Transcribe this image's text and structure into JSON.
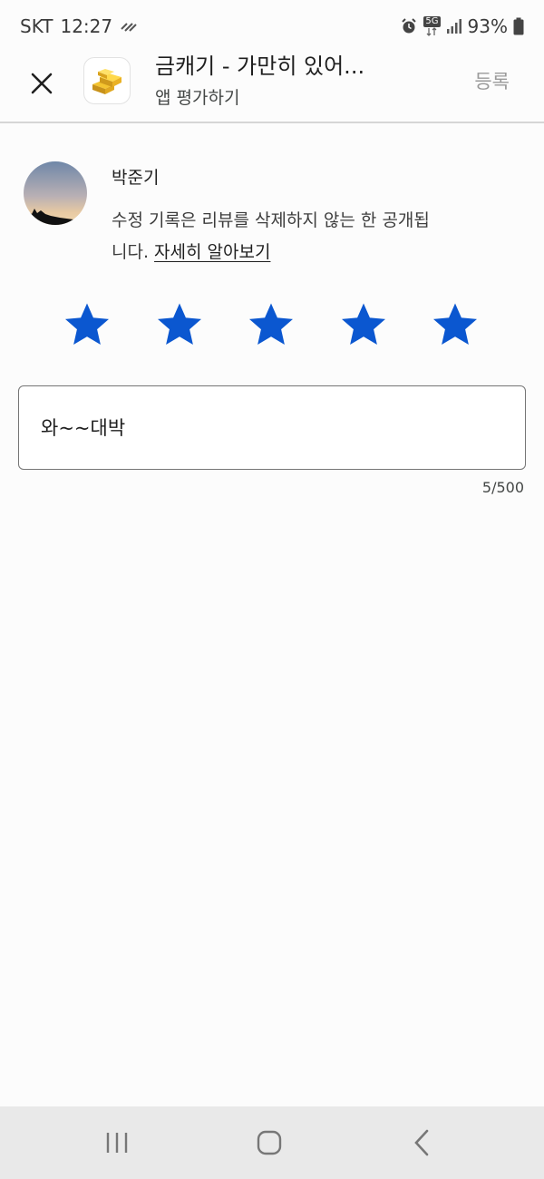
{
  "status_bar": {
    "carrier": "SKT",
    "time": "12:27",
    "network": "5G",
    "battery": "93%"
  },
  "app_bar": {
    "title": "금캐기 - 가만히 있어...",
    "subtitle": "앱 평가하기",
    "submit_label": "등록"
  },
  "profile": {
    "name": "박준기",
    "notice_text": "수정 기록은 리뷰를 삭제하지 않는 한 공개됩니다.",
    "notice_link": "자세히 알아보기"
  },
  "rating": {
    "value": 5,
    "max": 5
  },
  "review": {
    "text": "와~~대박",
    "char_count": "5/500"
  },
  "colors": {
    "star": "#0b57d0",
    "accent": "#0b57d0",
    "background": "#fcfcfc"
  }
}
